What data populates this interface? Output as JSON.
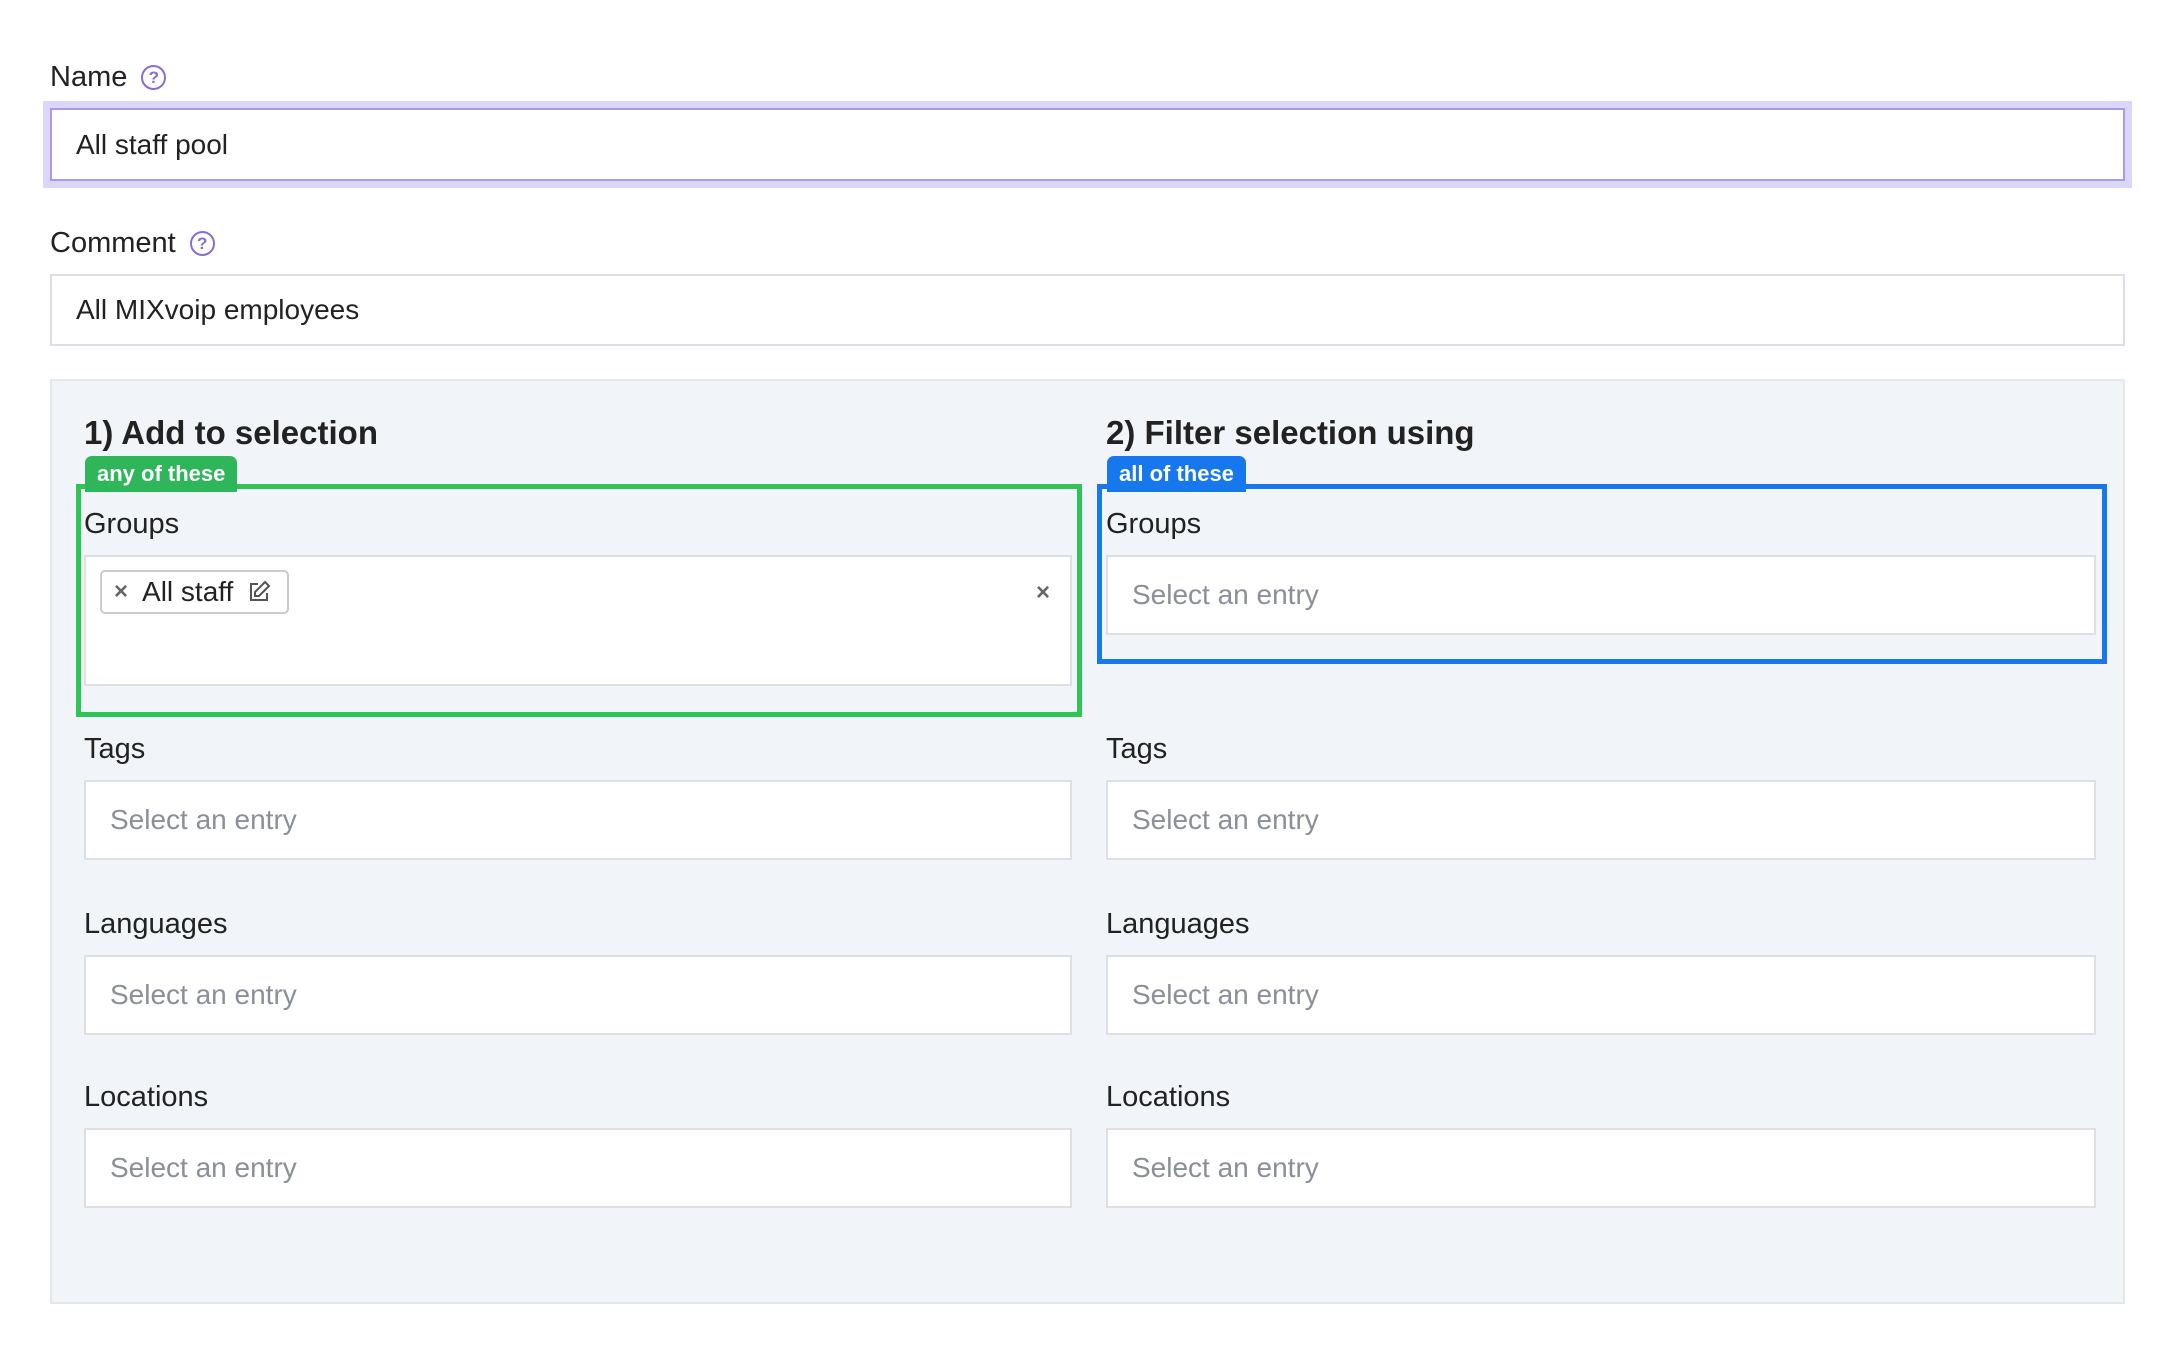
{
  "name_field": {
    "label": "Name",
    "value": "All staff pool",
    "help_icon": "question-circle-icon"
  },
  "comment_field": {
    "label": "Comment",
    "value": "All MIXvoip employees",
    "help_icon": "question-circle-icon"
  },
  "add_section": {
    "title": "1) Add to selection",
    "badge": "any of these",
    "badge_color": "#2fb65a",
    "groups": {
      "label": "Groups",
      "chips": [
        {
          "label": "All staff",
          "remove_glyph": "×",
          "edit_icon": "edit-icon"
        }
      ],
      "clear_glyph": "×"
    },
    "tags": {
      "label": "Tags",
      "placeholder": "Select an entry"
    },
    "languages": {
      "label": "Languages",
      "placeholder": "Select an entry"
    },
    "locations": {
      "label": "Locations",
      "placeholder": "Select an entry"
    }
  },
  "filter_section": {
    "title": "2) Filter selection using",
    "badge": "all of these",
    "badge_color": "#1778ed",
    "groups": {
      "label": "Groups",
      "placeholder": "Select an entry"
    },
    "tags": {
      "label": "Tags",
      "placeholder": "Select an entry"
    },
    "languages": {
      "label": "Languages",
      "placeholder": "Select an entry"
    },
    "locations": {
      "label": "Locations",
      "placeholder": "Select an entry"
    }
  },
  "colors": {
    "accent_purple": "#8a6cd6",
    "focus_ring": "#ddd6fb",
    "panel_bg": "#f1f4f8",
    "green_frame": "#2ec456",
    "blue_frame": "#1778ed"
  }
}
